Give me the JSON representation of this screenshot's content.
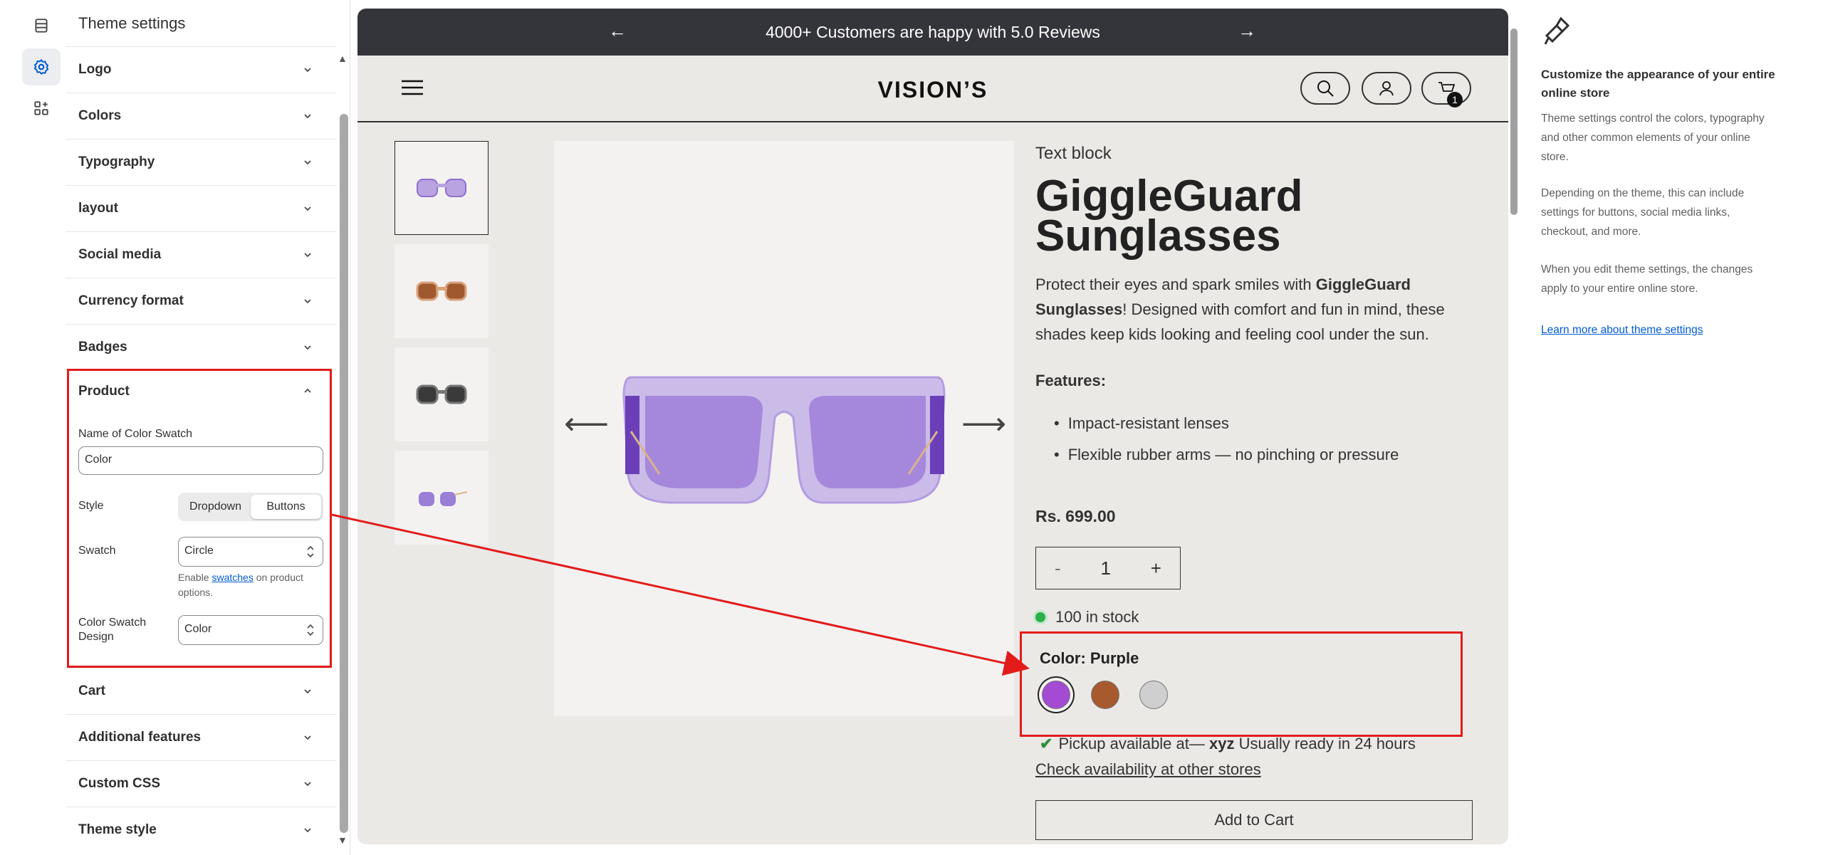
{
  "panel": {
    "title": "Theme settings",
    "sections": [
      {
        "label": "Logo"
      },
      {
        "label": "Colors"
      },
      {
        "label": "Typography"
      },
      {
        "label": "layout"
      },
      {
        "label": "Social media"
      },
      {
        "label": "Currency format"
      },
      {
        "label": "Badges"
      }
    ],
    "product": {
      "label": "Product",
      "swatch_name_label": "Name of Color Swatch",
      "swatch_name_value": "Color",
      "style_label": "Style",
      "style_options": [
        "Dropdown",
        "Buttons"
      ],
      "style_selected": "Buttons",
      "swatch_label": "Swatch",
      "swatch_value": "Circle",
      "help_prefix": "Enable ",
      "help_link": "swatches",
      "help_suffix": " on product options.",
      "design_label": "Color Swatch Design",
      "design_value": "Color"
    },
    "sections_after": [
      {
        "label": "Cart"
      },
      {
        "label": "Additional features"
      },
      {
        "label": "Custom CSS"
      },
      {
        "label": "Theme style"
      }
    ]
  },
  "preview": {
    "announcement": "4000+ Customers are happy with 5.0 Reviews",
    "brand": "VISION’S",
    "cart_count": "1",
    "text_block": "Text block",
    "title_line1": "GiggleGuard",
    "title_line2": "Sunglasses",
    "desc_prefix": "Protect their eyes and spark smiles with ",
    "desc_bold": "GiggleGuard Sunglasses",
    "desc_suffix": "! Designed with comfort and fun in mind, these shades keep kids looking and feeling cool under the sun.",
    "features_heading": "Features:",
    "features": [
      "Impact-resistant lenses",
      "Flexible rubber arms — no pinching or pressure"
    ],
    "price": "Rs. 699.00",
    "qty_minus": "-",
    "qty_value": "1",
    "qty_plus": "+",
    "stock": "100 in stock",
    "color_label": "Color: Purple",
    "swatch_colors": [
      "#a54ad3",
      "#a65a2e",
      "#cfcfcf"
    ],
    "thumb_lens_colors": [
      "#b9a3e0",
      "#a0582e",
      "#3a3a3a",
      "#9b7ed6"
    ],
    "pickup_prefix": "Pickup available at— ",
    "pickup_store": "xyz",
    "pickup_suffix": " Usually ready in 24 hours",
    "check_link": "Check availability at other stores",
    "add_to_cart": "Add to Cart"
  },
  "info": {
    "heading": "Customize the appearance of your entire online store",
    "p1": "Theme settings control the colors, typography and other common elements of your online store.",
    "p2": "Depending on the theme, this can include settings for buttons, social media links, checkout, and more.",
    "p3": "When you edit theme settings, the changes apply to your entire online store.",
    "link": "Learn more about theme settings"
  },
  "colors": {
    "highlight": "#e31b1b",
    "announcement_bg": "#34343b",
    "preview_bg": "#ebe9e6",
    "link": "#005bd3"
  }
}
